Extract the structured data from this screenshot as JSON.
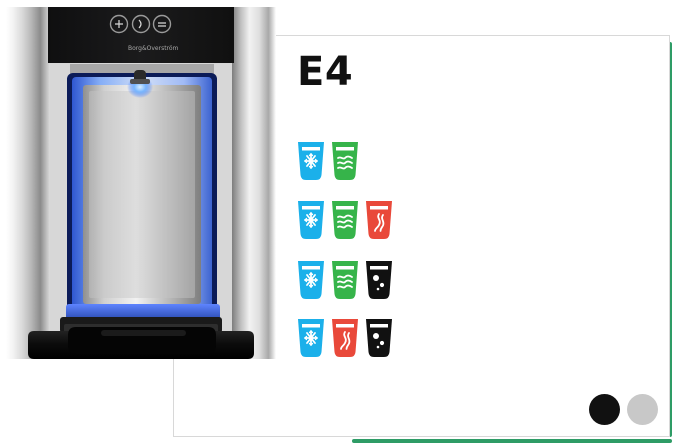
{
  "product": {
    "brand_text": "Borg&Overström",
    "model": "E4"
  },
  "variants": [
    {
      "icons": [
        "cold-water",
        "ambient-water"
      ]
    },
    {
      "icons": [
        "cold-water",
        "ambient-water",
        "hot-water"
      ]
    },
    {
      "icons": [
        "cold-water",
        "ambient-water",
        "sparkling-water"
      ]
    },
    {
      "icons": [
        "cold-water",
        "hot-water",
        "sparkling-water"
      ]
    }
  ],
  "icon_colors": {
    "cold": "#1bb0ea",
    "ambient": "#36b44a",
    "hot": "#e9493a",
    "sparkling": "#111111"
  },
  "finish_colors": [
    {
      "color": "#111111"
    },
    {
      "color": "#c8c8c8"
    }
  ]
}
